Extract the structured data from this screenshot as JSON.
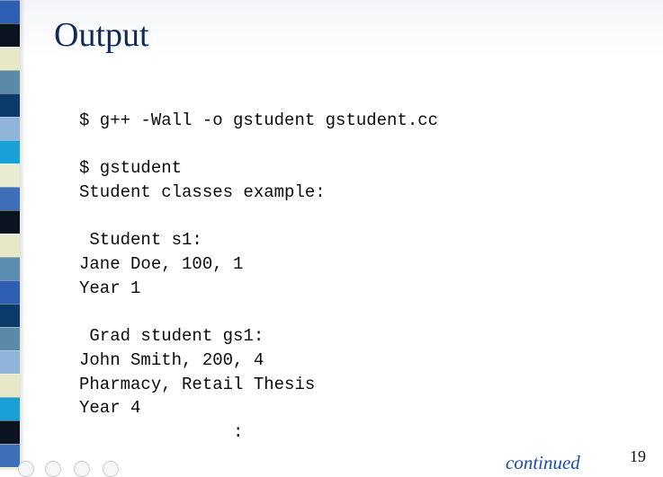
{
  "slide": {
    "title": "Output",
    "code_lines": [
      "$ g++ -Wall -o gstudent gstudent.cc",
      "",
      "$ gstudent",
      "Student classes example:",
      "",
      " Student s1:",
      "Jane Doe, 100, 1",
      "Year 1",
      "",
      " Grad student gs1:",
      "John Smith, 200, 4",
      "Pharmacy, Retail Thesis",
      "Year 4",
      "               :"
    ],
    "continued_label": "continued",
    "page_number": "19"
  },
  "nav": {
    "icons": [
      "prev-slide-icon",
      "menu-icon",
      "pen-icon",
      "next-slide-icon"
    ]
  },
  "colors": {
    "title": "#112a5c",
    "continued": "#1c4da0",
    "strip_palette": [
      "#2f5fb3",
      "#0b1220",
      "#e6e8c8",
      "#5a8aa8",
      "#0b3a6b",
      "#8fb3d9",
      "#1aa0d8",
      "#e9ecd0",
      "#3f6fb8",
      "#5b8db0"
    ]
  }
}
